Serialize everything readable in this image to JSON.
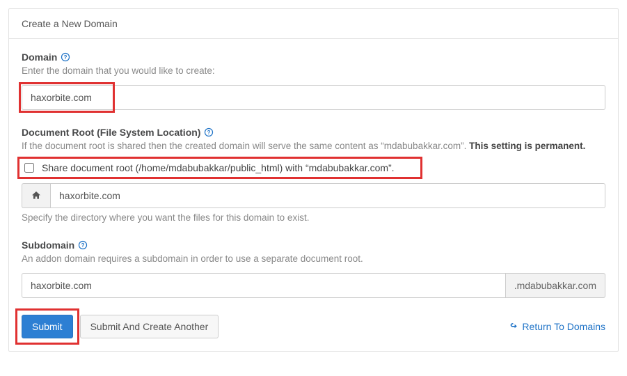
{
  "panel": {
    "title": "Create a New Domain"
  },
  "domain": {
    "label": "Domain",
    "desc": "Enter the domain that you would like to create:",
    "value": "haxorbite.com"
  },
  "docroot": {
    "label": "Document Root (File System Location)",
    "desc_prefix": "If the document root is shared then the created domain will serve the same content as “mdabubakkar.com”. ",
    "desc_strong": "This setting is permanent.",
    "share_label": "Share document root (/home/mdabubakkar/public_html) with “mdabubakkar.com”.",
    "path_value": "haxorbite.com",
    "note": "Specify the directory where you want the files for this domain to exist."
  },
  "subdomain": {
    "label": "Subdomain",
    "desc": "An addon domain requires a subdomain in order to use a separate document root.",
    "value": "haxorbite.com",
    "suffix": ".mdabubakkar.com"
  },
  "actions": {
    "submit": "Submit",
    "submit_another": "Submit And Create Another",
    "return": "Return To Domains"
  }
}
